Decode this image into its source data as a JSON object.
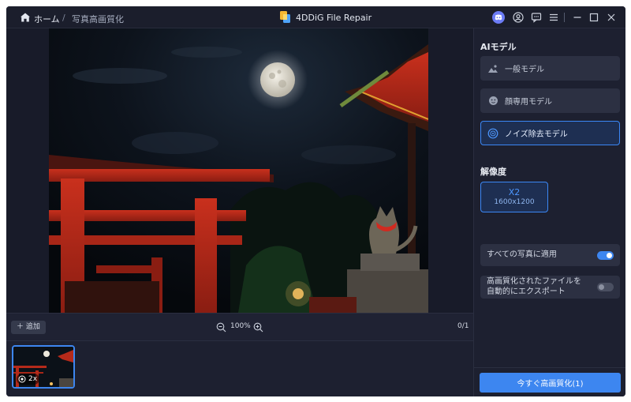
{
  "titlebar": {
    "breadcrumb_home": "ホーム",
    "breadcrumb_separator": "/",
    "breadcrumb_page": "写真高画質化",
    "app_title": "4DDiG File Repair",
    "icons": [
      "discord-icon",
      "account-icon",
      "feedback-icon",
      "menu-icon",
      "minimize-icon",
      "maximize-icon",
      "close-icon"
    ]
  },
  "toolbar": {
    "add_label": "＋ 追加",
    "zoom_level": "100%",
    "page_count": "0/1"
  },
  "thumbnails": [
    {
      "scale_label": "2x"
    }
  ],
  "side_panel": {
    "model_heading": "AIモデル",
    "models": [
      {
        "label": "一般モデル",
        "icon": "landscape-icon",
        "active": false
      },
      {
        "label": "顔専用モデル",
        "icon": "face-icon",
        "active": false
      },
      {
        "label": "ノイズ除去モデル",
        "icon": "noise-icon",
        "active": true
      }
    ],
    "resolution_heading": "解像度",
    "resolution": {
      "scale": "X2",
      "dimensions": "1600x1200"
    },
    "apply_all_label": "すべての写真に適用",
    "apply_all_enabled": true,
    "auto_export_line1": "高画質化されたファイルを",
    "auto_export_line2": "自動的にエクスポート",
    "auto_export_enabled": false,
    "enhance_button": "今すぐ高画質化(1)"
  },
  "colors": {
    "accent": "#3d86f0",
    "background": "#1d2030"
  }
}
